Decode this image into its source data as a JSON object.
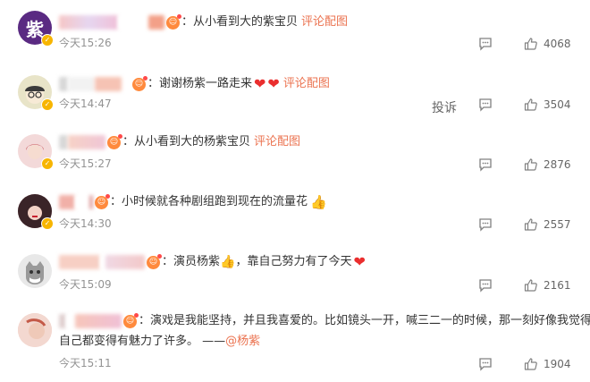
{
  "comments": [
    {
      "text": "：从小看到大的紫宝贝",
      "link": "评论配图",
      "time": "今天15:26",
      "likes": "4068",
      "avatar_char": "紫",
      "avatar_color": "#5a2a82"
    },
    {
      "text": "：谢谢杨紫一路走来",
      "link": "评论配图",
      "time": "今天14:47",
      "likes": "3504",
      "report": "投诉",
      "avatar_color": "#e8e4c8"
    },
    {
      "text": "：从小看到大的杨紫宝贝",
      "link": "评论配图",
      "time": "今天15:27",
      "likes": "2876",
      "avatar_color": "#f3d9d9"
    },
    {
      "text": "：小时候就各种剧组跑到现在的流量花",
      "time": "今天14:30",
      "likes": "2557",
      "avatar_color": "#d8a0a8"
    },
    {
      "text_a": "：演员杨紫",
      "text_b": "，靠自己努力有了今天",
      "time": "今天15:09",
      "likes": "2161",
      "avatar_color": "#e8e8e8"
    },
    {
      "text_line1": "：演戏是我能坚持，并且我喜爱的。比如镜头一开，喊三二一的时候，那一刻好像我觉得",
      "text_line2": "自己都变得有魅力了许多。 ——",
      "mention": "@杨紫",
      "time": "今天15:11",
      "likes": "1904",
      "avatar_color": "#f2c9c0"
    }
  ],
  "colors": {
    "link": "#eb7350",
    "time": "#939393",
    "vbadge": "#f7b500"
  }
}
